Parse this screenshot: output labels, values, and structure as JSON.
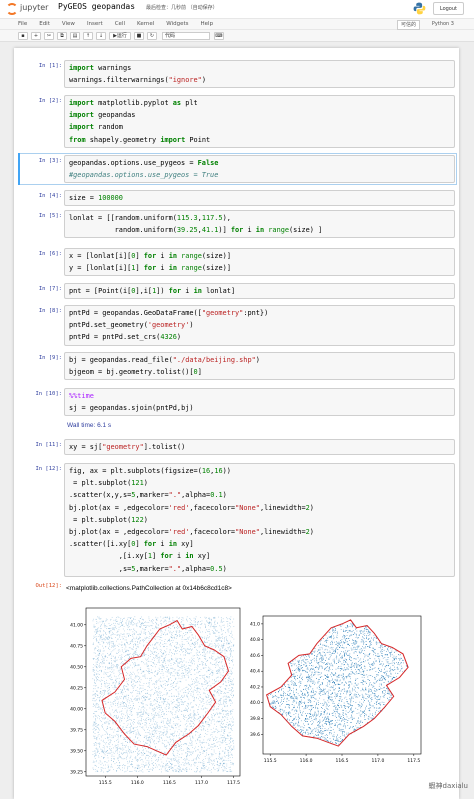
{
  "header": {
    "brand": "jupyter",
    "notebook_name": "PyGEOS geopandas",
    "checkpoint": "最后检查：几秒前 （自动保存）",
    "logout": "Logout"
  },
  "menu": {
    "items": [
      "File",
      "Edit",
      "View",
      "Insert",
      "Cell",
      "Kernel",
      "Widgets",
      "Help"
    ],
    "trusted": "可信的",
    "kernel": "Python 3"
  },
  "toolbar": {
    "run_label": "运行",
    "cell_type": "代码"
  },
  "cells": [
    {
      "prompt": "In [1]:",
      "lines": [
        "import warnings",
        "warnings.filterwarnings(\"ignore\")"
      ]
    },
    {
      "prompt": "In [2]:",
      "lines": [
        "import matplotlib.pyplot as plt",
        "import geopandas",
        "import random",
        "from shapely.geometry import Point"
      ]
    },
    {
      "prompt": "In [3]:",
      "lines": [
        "geopandas.options.use_pygeos = False",
        "#geopandas.options.use_pygeos = True"
      ]
    },
    {
      "prompt": "In [4]:",
      "lines": [
        "size = 100000"
      ]
    },
    {
      "prompt": "In [5]:",
      "lines": [
        "lonlat = [[random.uniform(115.3,117.5),",
        "           random.uniform(39.25,41.1)] for i in range(size) ]"
      ]
    },
    {
      "prompt": "In [6]:",
      "lines": [
        "x = [lonlat[i][0] for i in range(size)]",
        "y = [lonlat[i][1] for i in range(size)]"
      ]
    },
    {
      "prompt": "In [7]:",
      "lines": [
        "pnt = [Point(i[0],i[1]) for i in lonlat]"
      ]
    },
    {
      "prompt": "In [8]:",
      "lines": [
        "pntPd = geopandas.GeoDataFrame([\"geometry\":pnt})",
        "pntPd.set_geometry('geometry')",
        "pntPd = pntPd.set_crs(4326)"
      ]
    },
    {
      "prompt": "In [9]:",
      "lines": [
        "bj = geopandas.read_file(\"./data/beijing.shp\")",
        "bjgeom = bj.geometry.tolist()[0]"
      ]
    },
    {
      "prompt": "In [10]:",
      "lines": [
        "%%time",
        "sj = geopandas.sjoin(pntPd,bj)"
      ]
    },
    {
      "prompt": "In [11]:",
      "lines": [
        "xy = sj[\"geometry\"].tolist()"
      ]
    },
    {
      "prompt": "In [12]:",
      "lines": [
        "fig, ax = plt.subplots(figsize=(16,16))",
        "ax1 = plt.subplot(121)",
        "ax1.scatter(x,y,s=5,marker=\".\",alpha=0.1)",
        "bj.plot(ax = ax1,edgecolor='red',facecolor=\"None\",linewidth=2)",
        "ax2 = plt.subplot(122)",
        "bj.plot(ax = ax2,edgecolor='red',facecolor=\"None\",linewidth=2)",
        "ax2.scatter([i.xy[0] for i in xy]",
        "            ,[i.xy[1] for i in xy]",
        "            ,s=5,marker=\".\",alpha=0.5)"
      ]
    }
  ],
  "outputs": {
    "walltime": "Wall time: 6.1 s",
    "out_prompt": "Out[12]:",
    "out_text": "<matplotlib.collections.PathCollection at 0x14b6c8cd1c8>"
  },
  "chart_data": [
    {
      "type": "scatter",
      "title": "",
      "xlabel": "",
      "ylabel": "",
      "xlim": [
        115.2,
        117.6
      ],
      "ylim": [
        39.2,
        41.2
      ],
      "xticks": [
        "115.5",
        "116.0",
        "116.5",
        "117.0",
        "117.5"
      ],
      "yticks": [
        "39.25",
        "39.50",
        "39.75",
        "40.00",
        "40.25",
        "40.50",
        "40.75",
        "41.00"
      ],
      "series": [
        {
          "values": "uniform random points",
          "color": "#1f77b4"
        },
        {
          "values": "Beijing boundary outline",
          "color": "#d62728"
        }
      ]
    },
    {
      "type": "scatter",
      "title": "",
      "xlabel": "",
      "ylabel": "",
      "xlim": [
        115.4,
        117.6
      ],
      "ylim": [
        39.35,
        41.1
      ],
      "xticks": [
        "115.5",
        "116.0",
        "116.5",
        "117.0",
        "117.5"
      ],
      "yticks": [
        "39.6",
        "39.8",
        "40.0",
        "40.2",
        "40.4",
        "40.6",
        "40.8",
        "41.0"
      ],
      "series": [
        {
          "values": "points within Beijing boundary",
          "color": "#1f77b4"
        },
        {
          "values": "Beijing boundary outline",
          "color": "#d62728"
        }
      ]
    }
  ],
  "watermark": "蝦神daxialu"
}
